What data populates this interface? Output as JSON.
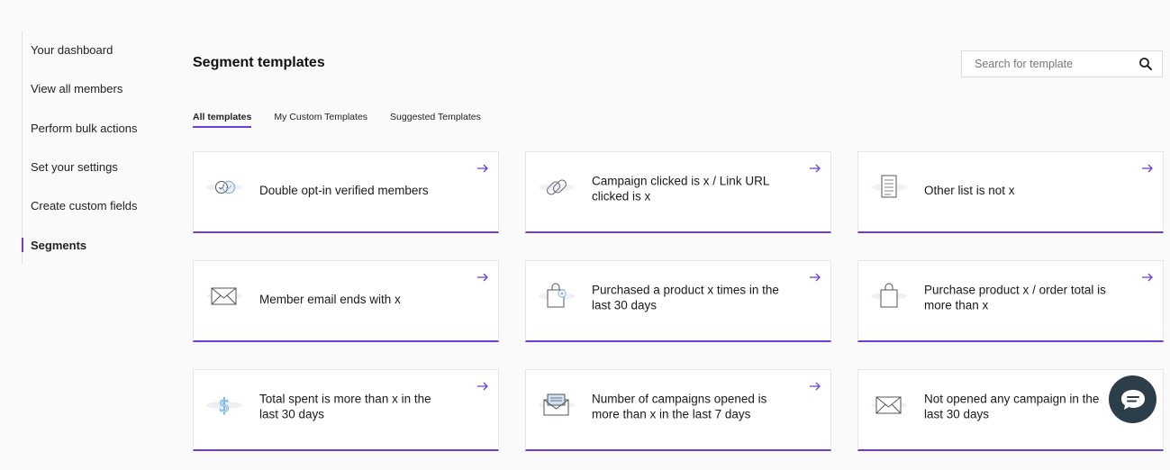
{
  "sidebar": {
    "items": [
      {
        "label": "Your dashboard"
      },
      {
        "label": "View all members"
      },
      {
        "label": "Perform bulk actions"
      },
      {
        "label": "Set your settings"
      },
      {
        "label": "Create custom fields"
      },
      {
        "label": "Segments",
        "active": true
      }
    ]
  },
  "header": {
    "title": "Segment templates"
  },
  "search": {
    "placeholder": "Search for template",
    "icon": "search-icon"
  },
  "tabs": [
    {
      "label": "All templates",
      "active": true
    },
    {
      "label": "My Custom Templates"
    },
    {
      "label": "Suggested Templates"
    }
  ],
  "cards": [
    {
      "label": "Double opt-in verified members",
      "icon": "verified-check-icon"
    },
    {
      "label": "Campaign clicked is x / Link URL clicked is x",
      "icon": "link-icon"
    },
    {
      "label": "Other list is not x",
      "icon": "list-document-icon"
    },
    {
      "label": "Member email ends with x",
      "icon": "envelope-icon"
    },
    {
      "label": "Purchased a product x times in the last 30 days",
      "icon": "shopping-bag-plus-icon"
    },
    {
      "label": "Purchase product x / order total is more than x",
      "icon": "shopping-bag-icon"
    },
    {
      "label": "Total spent is more than x in the last 30 days",
      "icon": "dollar-icon"
    },
    {
      "label": "Number of campaigns opened is more than x in the last 7 days",
      "icon": "open-envelope-icon"
    },
    {
      "label": "Not opened any campaign in the last 30 days",
      "icon": "envelope-icon"
    }
  ],
  "colors": {
    "accent": "#6b3fd6",
    "chat_bg": "#2c3e4a"
  }
}
